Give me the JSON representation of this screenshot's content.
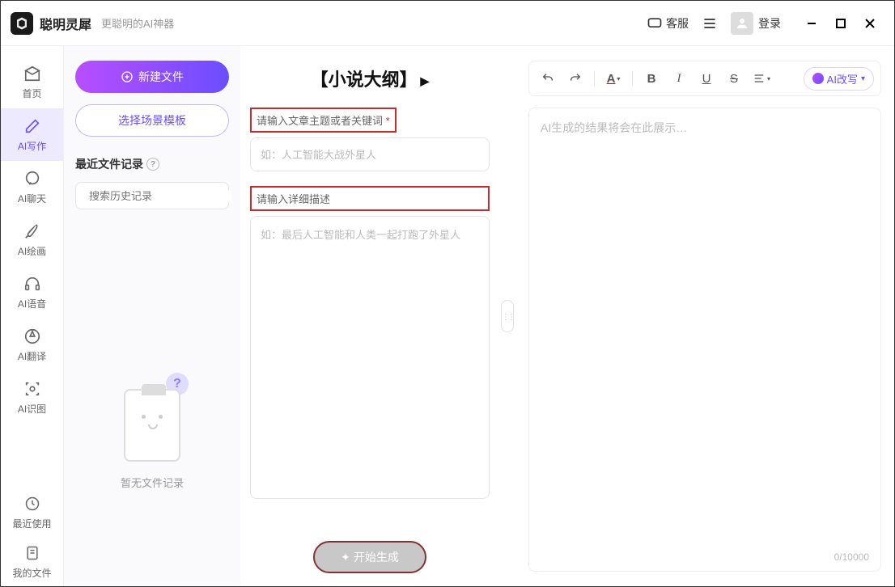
{
  "titlebar": {
    "app_name": "聪明灵犀",
    "subtitle": "更聪明的AI神器",
    "service_label": "客服",
    "login_label": "登录"
  },
  "sidebar": {
    "items": [
      {
        "label": "首页"
      },
      {
        "label": "AI写作"
      },
      {
        "label": "AI聊天"
      },
      {
        "label": "AI绘画"
      },
      {
        "label": "AI语音"
      },
      {
        "label": "AI翻译"
      },
      {
        "label": "AI识图"
      }
    ],
    "bottom": [
      {
        "label": "最近使用"
      },
      {
        "label": "我的文件"
      }
    ]
  },
  "left": {
    "new_file": "新建文件",
    "template_btn": "选择场景模板",
    "recent_title": "最近文件记录",
    "search_placeholder": "搜索历史记录",
    "empty_text": "暂无文件记录"
  },
  "middle": {
    "title": "【小说大纲】",
    "topic_label": "请输入文章主题或者关键词",
    "topic_placeholder": "如：人工智能大战外星人",
    "desc_label": "请输入详细描述",
    "desc_placeholder": "如：最后人工智能和人类一起打跑了外星人",
    "generate_label": "开始生成"
  },
  "right": {
    "ai_rewrite": "AI改写",
    "editor_placeholder": "AI生成的结果将会在此展示…",
    "counter": "0/10000"
  }
}
